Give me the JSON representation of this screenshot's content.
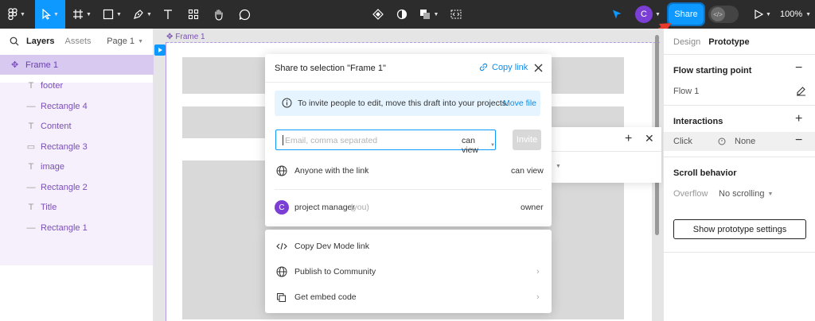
{
  "toolbar": {
    "zoom": "100%",
    "share_label": "Share",
    "user_initial": "C"
  },
  "left_panel": {
    "tabs": {
      "layers": "Layers",
      "assets": "Assets",
      "page": "Page 1"
    },
    "layers": [
      {
        "name": "Frame 1",
        "icon": "frame-icon"
      },
      {
        "name": "footer",
        "icon": "text-icon"
      },
      {
        "name": "Rectangle 4",
        "icon": "line-icon"
      },
      {
        "name": "Content",
        "icon": "text-icon"
      },
      {
        "name": "Rectangle 3",
        "icon": "rectangle-icon"
      },
      {
        "name": "image",
        "icon": "text-icon"
      },
      {
        "name": "Rectangle 2",
        "icon": "line-icon"
      },
      {
        "name": "Title",
        "icon": "text-icon"
      },
      {
        "name": "Rectangle 1",
        "icon": "line-icon"
      }
    ]
  },
  "canvas": {
    "frame_label": "Frame 1"
  },
  "right_panel": {
    "tabs": {
      "design": "Design",
      "prototype": "Prototype"
    },
    "flow_starting_point": "Flow starting point",
    "flow_name": "Flow 1",
    "interactions": "Interactions",
    "interaction_trigger": "Click",
    "interaction_action": "None",
    "scroll_behavior": "Scroll behavior",
    "overflow_label": "Overflow",
    "overflow_value": "No scrolling",
    "settings_button": "Show prototype settings"
  },
  "share_dialog": {
    "title": "Share to selection \"Frame 1\"",
    "copy_link": "Copy link",
    "info_text": "To invite people to edit, move this draft into your projects.",
    "move_file": "Move file",
    "email_placeholder": "Email, comma separated",
    "permission": "can view",
    "invite_label": "Invite",
    "link_access": "Anyone with the link",
    "link_permission": "can view",
    "member_initial": "C",
    "member_name": "project manager",
    "member_you": "(you)",
    "member_role": "owner"
  },
  "share_options": {
    "dev_mode_link": "Copy Dev Mode link",
    "publish_community": "Publish to Community",
    "embed_code": "Get embed code"
  }
}
